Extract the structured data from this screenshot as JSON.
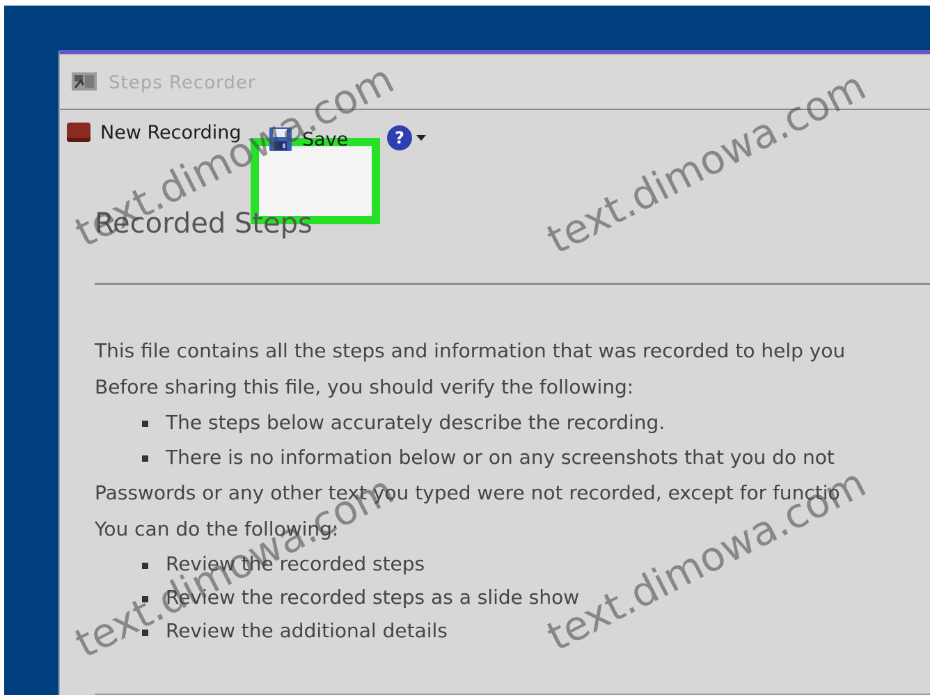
{
  "window": {
    "title": "Steps Recorder"
  },
  "toolbar": {
    "new_recording_label": "New Recording",
    "save_label": "Save",
    "help_icon": "help-icon",
    "help_glyph": "?"
  },
  "document": {
    "heading": "Recorded Steps",
    "intro": "This file contains all the steps and information that was recorded to help you",
    "verify_prompt": "Before sharing this file, you should verify the following:",
    "verify_items": [
      "The steps below accurately describe the recording.",
      "There is no information below or on any screenshots that you do not"
    ],
    "passwords_note": "Passwords or any other text you typed were not recorded, except for functio",
    "actions_prompt": "You can do the following:",
    "action_items": [
      "Review the recorded steps",
      "Review the recorded steps as a slide show",
      "Review the additional details"
    ]
  },
  "watermark": "text.dimowa.com",
  "colors": {
    "outer_frame": "#003f7d",
    "window_bg": "#d7d7d7",
    "highlight": "#27e027",
    "help_icon": "#2e3fb0"
  }
}
